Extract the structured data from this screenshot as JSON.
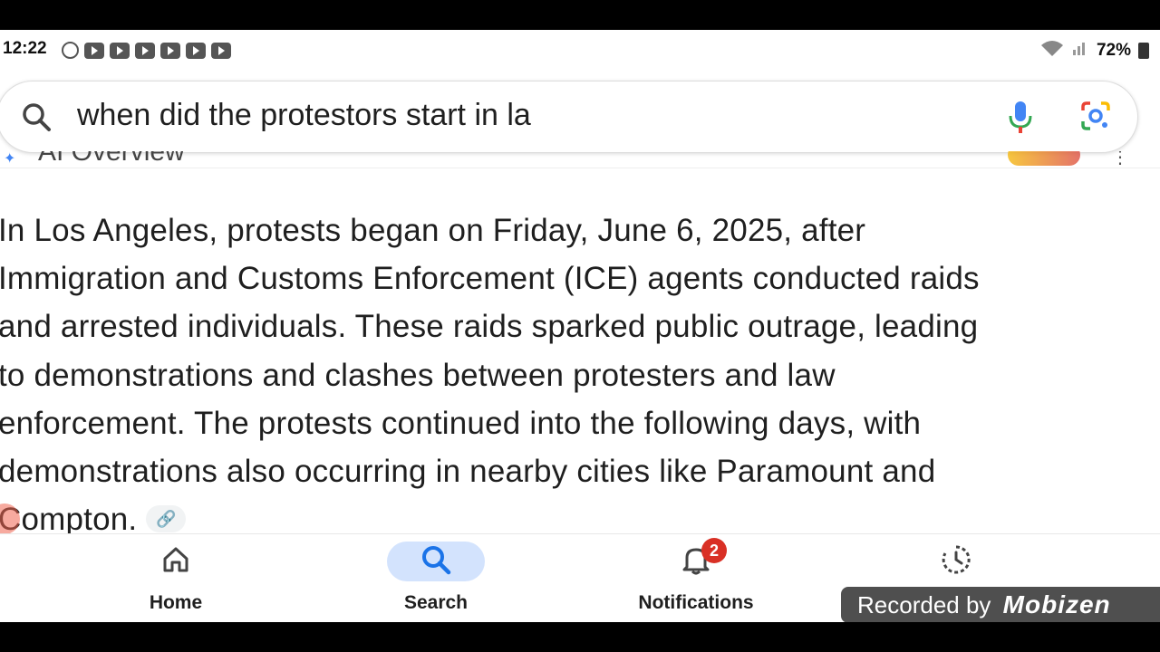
{
  "status_bar": {
    "time": "12:22",
    "battery": "72%"
  },
  "search": {
    "query": "when did the protestors start in la"
  },
  "overview": {
    "label": "AI Overview"
  },
  "answer": {
    "lines": [
      "In Los Angeles, protests began on Friday, June 6, 2025, after",
      "Immigration and Customs Enforcement (ICE) agents conducted raids",
      "and arrested individuals. These raids sparked public outrage, leading",
      "to demonstrations and clashes between protesters and law",
      "enforcement. The protests continued into the following days, with",
      "demonstrations also occurring in nearby cities like Paramount and",
      "Compton."
    ]
  },
  "bottom_nav": {
    "home": "Home",
    "search": "Search",
    "notifications": "Notifications",
    "notifications_badge": "2"
  },
  "watermark": {
    "text": "Recorded by",
    "brand": "Mobizen"
  },
  "colors": {
    "accent": "#1a73e8",
    "badge": "#d93025",
    "active_pill": "#d3e3fd"
  }
}
